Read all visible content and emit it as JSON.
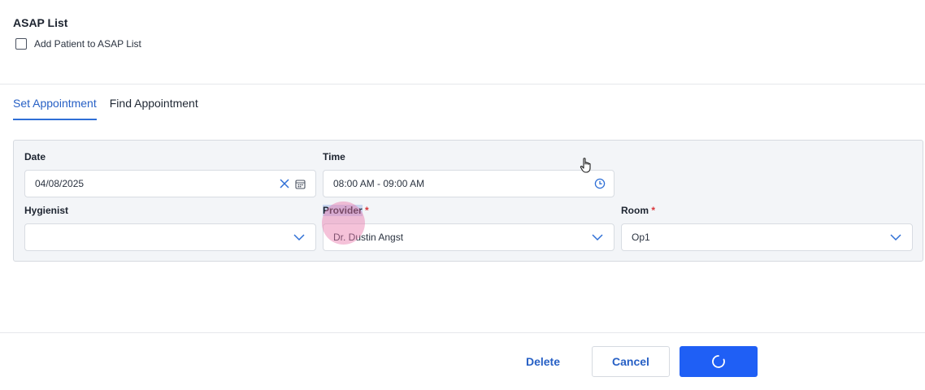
{
  "asap": {
    "title": "ASAP List",
    "checkbox_label": "Add Patient to ASAP List",
    "checked": false
  },
  "tabs": [
    {
      "label": "Set Appointment",
      "active": true
    },
    {
      "label": "Find Appointment",
      "active": false
    }
  ],
  "form": {
    "date": {
      "label": "Date",
      "value": "04/08/2025"
    },
    "time": {
      "label": "Time",
      "value": "08:00 AM - 09:00 AM"
    },
    "hygienist": {
      "label": "Hygienist",
      "value": ""
    },
    "provider": {
      "label": "Provider",
      "required_mark": "*",
      "value": "Dr. Dustin Angst"
    },
    "room": {
      "label": "Room",
      "required_mark": "*",
      "value": "Op1"
    }
  },
  "actions": {
    "delete_label": "Delete",
    "cancel_label": "Cancel",
    "save_state": "loading"
  },
  "icons": {
    "clear": "close-icon",
    "calendar": "calendar-icon",
    "clock": "clock-icon",
    "dropdown": "chevron-down-icon",
    "spinner": "spinner-icon",
    "cursor": "hand-cursor-icon"
  },
  "colors": {
    "accent": "#2760c5",
    "primary_button": "#1f5ff5",
    "required": "#d9373c",
    "panel_bg": "#f3f5f8"
  }
}
